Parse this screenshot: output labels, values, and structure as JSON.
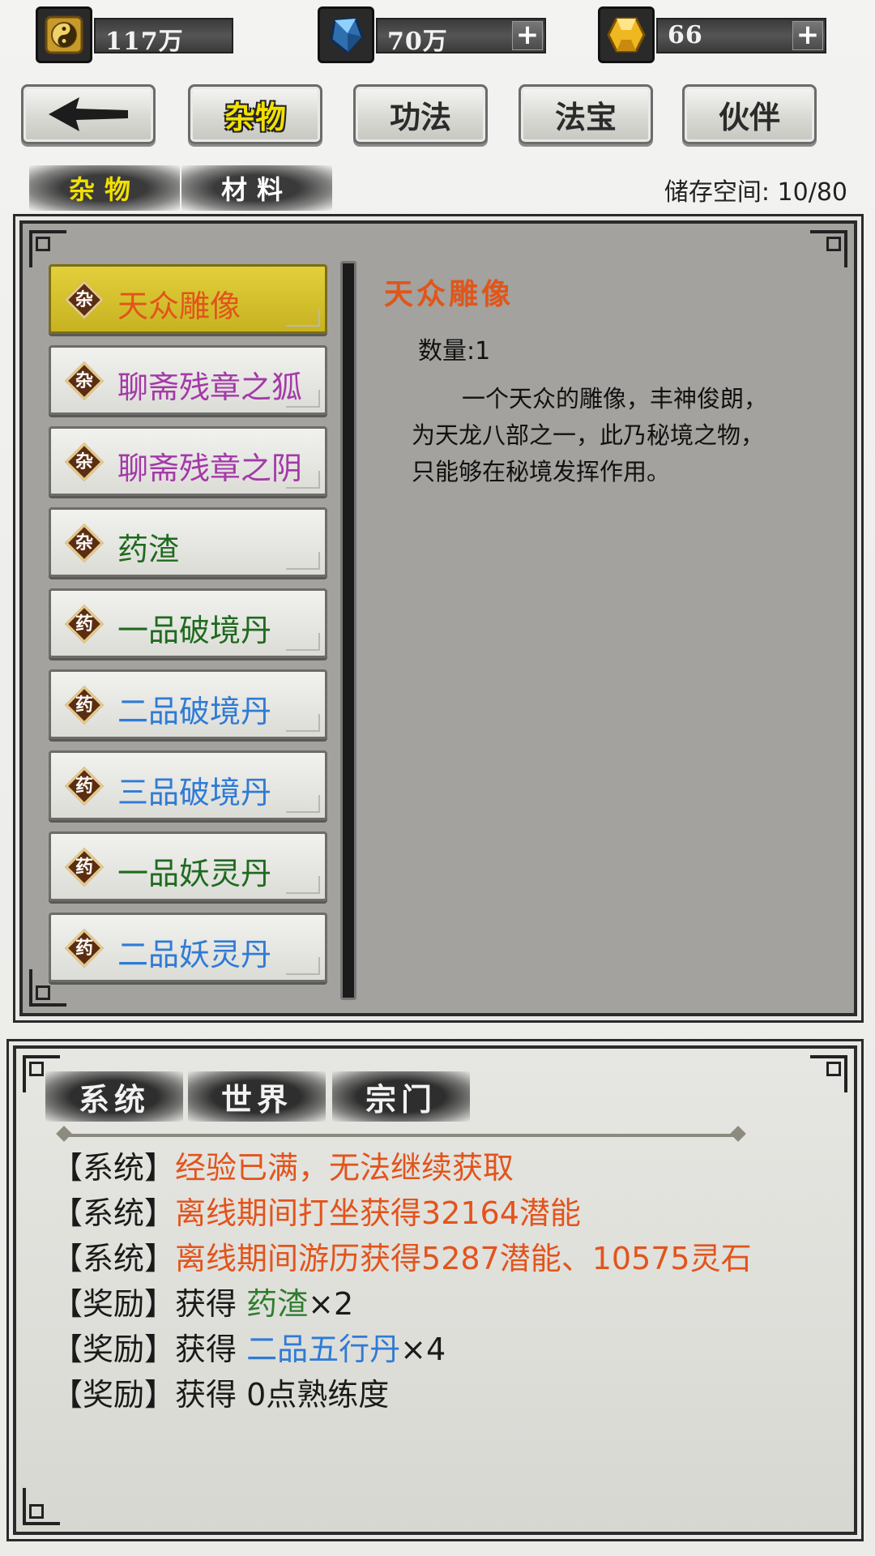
{
  "currencies": [
    {
      "icon": "yin-yang-coin-icon",
      "value": "117万",
      "has_plus": false
    },
    {
      "icon": "blue-crystal-icon",
      "value": "70万",
      "has_plus": true
    },
    {
      "icon": "gold-gem-icon",
      "value": "66",
      "has_plus": true
    }
  ],
  "nav": {
    "back_icon": "back-arrow-icon",
    "tabs": [
      "杂物",
      "功法",
      "法宝",
      "伙伴"
    ],
    "active_tab": "杂物"
  },
  "subtabs": {
    "items": [
      "杂物",
      "材料"
    ],
    "active": "杂物"
  },
  "storage": {
    "text": "储存空间: 10/80"
  },
  "colors": {
    "orange": "#e2541c",
    "purple": "#a43aa8",
    "green": "#1f6a1f",
    "blue": "#2f7bd6",
    "selected_bg": "#d6c22e"
  },
  "items": [
    {
      "badge": "杂",
      "name": "天众雕像",
      "color": "#e2541c",
      "selected": true
    },
    {
      "badge": "杂",
      "name": "聊斋残章之狐",
      "color": "#a43aa8",
      "selected": false
    },
    {
      "badge": "杂",
      "name": "聊斋残章之阴",
      "color": "#a43aa8",
      "selected": false
    },
    {
      "badge": "杂",
      "name": "药渣",
      "color": "#1f6a1f",
      "selected": false
    },
    {
      "badge": "药",
      "name": "一品破境丹",
      "color": "#1f6a1f",
      "selected": false
    },
    {
      "badge": "药",
      "name": "二品破境丹",
      "color": "#2f7bd6",
      "selected": false
    },
    {
      "badge": "药",
      "name": "三品破境丹",
      "color": "#2f7bd6",
      "selected": false
    },
    {
      "badge": "药",
      "name": "一品妖灵丹",
      "color": "#1f6a1f",
      "selected": false
    },
    {
      "badge": "药",
      "name": "二品妖灵丹",
      "color": "#2f7bd6",
      "selected": false
    }
  ],
  "detail": {
    "title": "天众雕像",
    "quantity": "数量:1",
    "description": "一个天众的雕像，丰神俊朗，为天龙八部之一，此乃秘境之物，只能够在秘境发挥作用。"
  },
  "chat": {
    "tabs": [
      "系统",
      "世界",
      "宗门"
    ],
    "messages": [
      {
        "tag": "【系统】",
        "parts": [
          {
            "text": "经验已满，无法继续获取",
            "style": "orange"
          }
        ]
      },
      {
        "tag": "【系统】",
        "parts": [
          {
            "text": "离线期间打坐获得32164潜能",
            "style": "orange"
          }
        ]
      },
      {
        "tag": "【系统】",
        "parts": [
          {
            "text": "离线期间游历获得5287潜能、10575灵石",
            "style": "orange"
          }
        ]
      },
      {
        "tag": "【奖励】",
        "parts": [
          {
            "text": "获得 ",
            "style": "plain"
          },
          {
            "text": "药渣",
            "style": "green"
          },
          {
            "text": "×2",
            "style": "plain"
          }
        ]
      },
      {
        "tag": "【奖励】",
        "parts": [
          {
            "text": "获得 ",
            "style": "plain"
          },
          {
            "text": "二品五行丹",
            "style": "blue"
          },
          {
            "text": "×4",
            "style": "plain"
          }
        ]
      },
      {
        "tag": "【奖励】",
        "parts": [
          {
            "text": "获得 0点熟练度",
            "style": "plain"
          }
        ]
      }
    ]
  }
}
